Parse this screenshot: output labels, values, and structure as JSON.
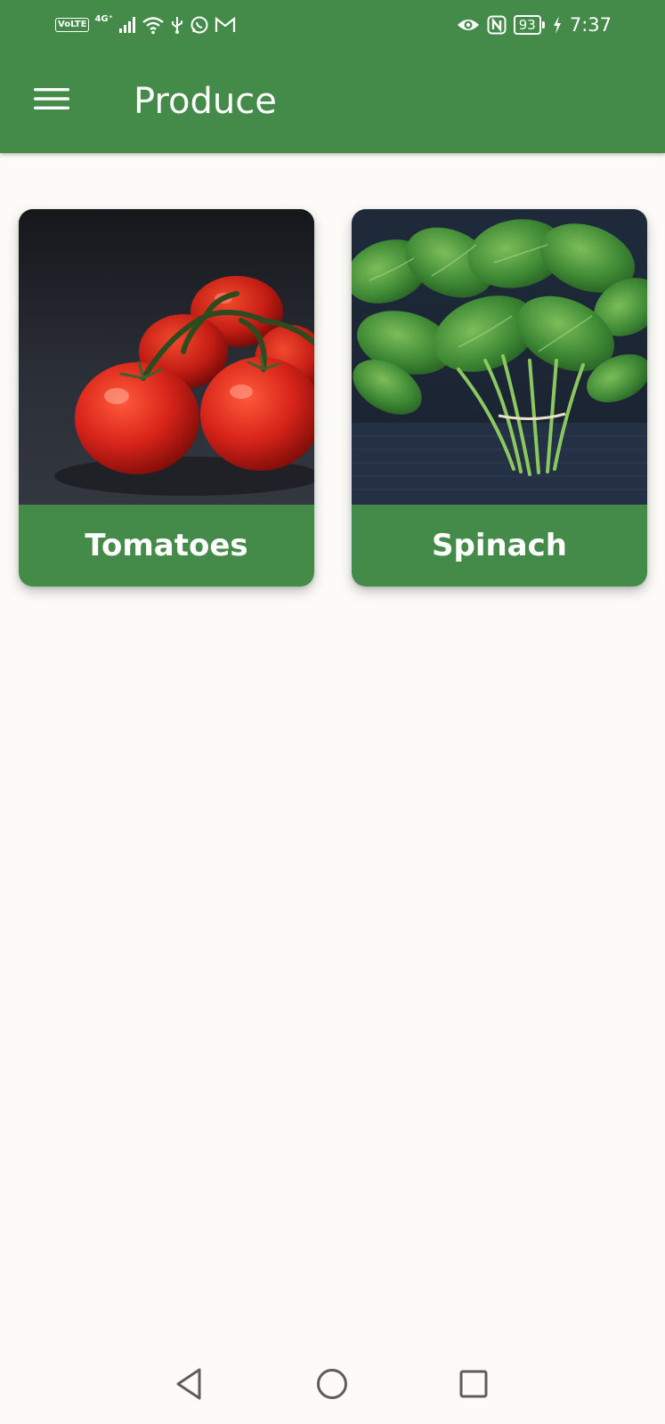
{
  "status_bar": {
    "volte": "VoLTE",
    "network_type": "4G⁺",
    "battery_level": "93",
    "time": "7:37",
    "icons_left": [
      "volte-badge",
      "signal-icon",
      "wifi-icon",
      "usb-icon",
      "whatsapp-icon",
      "gmail-icon"
    ],
    "icons_right": [
      "eye-icon",
      "nfc-icon",
      "battery-icon",
      "charging-icon"
    ]
  },
  "app_bar": {
    "title": "Produce",
    "menu_icon": "hamburger-menu-icon",
    "color": "#448a48"
  },
  "produce": [
    {
      "label": "Tomatoes",
      "image": "tomatoes-photo"
    },
    {
      "label": "Spinach",
      "image": "spinach-photo"
    }
  ],
  "nav_bar": {
    "buttons": [
      "back-triangle-icon",
      "home-circle-icon",
      "recents-square-icon"
    ]
  },
  "colors": {
    "primary": "#448a48",
    "background": "#fcfbf8",
    "on_primary": "#ffffff"
  }
}
